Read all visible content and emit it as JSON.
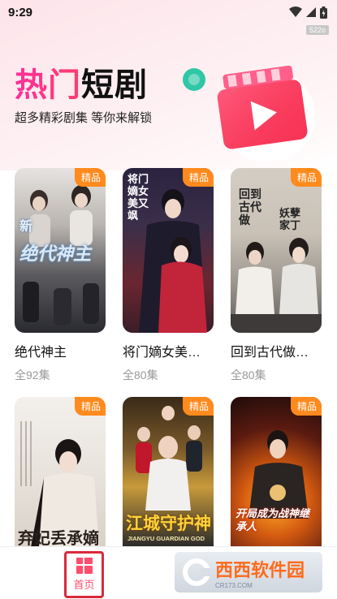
{
  "status_bar": {
    "time": "9:29",
    "version": "522o"
  },
  "hero": {
    "title_pink": "热门",
    "title_dark": "短剧",
    "subtitle": "超多精彩剧集 等你来解锁"
  },
  "colors": {
    "accent_pink": "#ff3d6e",
    "tag_orange": "#ff8a1d",
    "nav_active": "#ff4d6d"
  },
  "dramas": [
    {
      "tag": "精品",
      "title": "绝代神主",
      "episodes": "全92集",
      "poster_text": "绝代神主",
      "poster_small": "新"
    },
    {
      "tag": "精品",
      "title": "将门嫡女美…",
      "episodes": "全80集",
      "poster_text": "将门嫡女美又飒",
      "poster_small": ""
    },
    {
      "tag": "精品",
      "title": "回到古代做…",
      "episodes": "全80集",
      "poster_text": "回到古代做",
      "poster_small": "妖孽家丁"
    },
    {
      "tag": "精品",
      "title": "",
      "episodes": "",
      "poster_text": "弃妃丢承嫡",
      "poster_small": ""
    },
    {
      "tag": "精品",
      "title": "",
      "episodes": "",
      "poster_text": "江城守护神",
      "poster_small": "JIANGYU GUARDIAN GOD"
    },
    {
      "tag": "精品",
      "title": "",
      "episodes": "",
      "poster_text": "开局成为战神继承人",
      "poster_small": ""
    }
  ],
  "bottom_nav": {
    "home_label": "首页"
  },
  "watermark": {
    "main": "西西软件园",
    "sub": "CR173.COM"
  }
}
